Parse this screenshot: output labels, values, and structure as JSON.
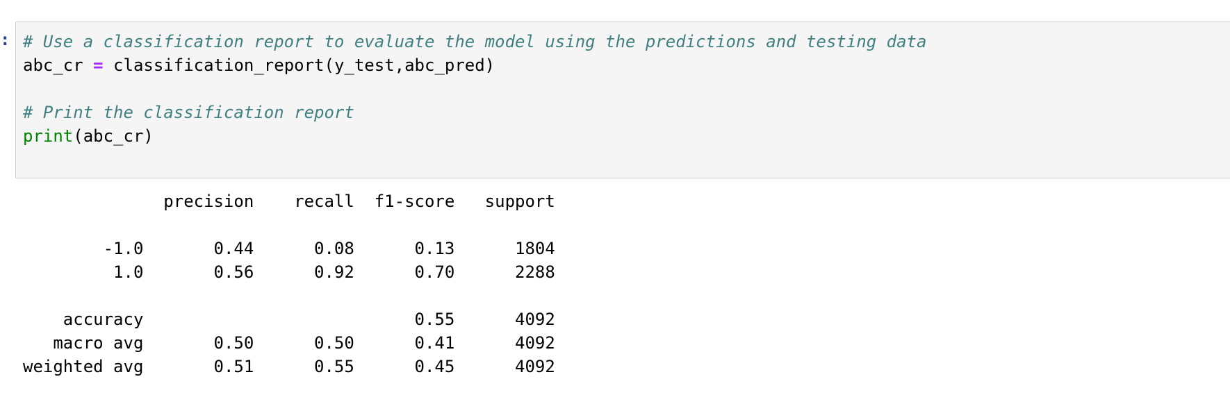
{
  "cell": {
    "prompt": ":",
    "lines": [
      {
        "comment": "# Use a classification report to evaluate the model using the predictions and testing data"
      },
      {
        "var": "abc_cr ",
        "op": "=",
        "call": " classification_report(y_test,abc_pred)"
      },
      {
        "blank": ""
      },
      {
        "comment": "# Print the classification report"
      },
      {
        "builtin": "print",
        "args": "(abc_cr)"
      }
    ]
  },
  "output": {
    "lines": [
      "              precision    recall  f1-score   support",
      "",
      "        -1.0       0.44      0.08      0.13      1804",
      "         1.0       0.56      0.92      0.70      2288",
      "",
      "    accuracy                           0.55      4092",
      "   macro avg       0.50      0.50      0.41      4092",
      "weighted avg       0.51      0.55      0.45      4092"
    ]
  },
  "colors": {
    "comment": "#408080",
    "operator": "#aa22ff",
    "builtin": "#008000",
    "cell_background": "#f5f5f5",
    "cell_border": "#cfcfcf",
    "prompt": "#303f9f"
  }
}
